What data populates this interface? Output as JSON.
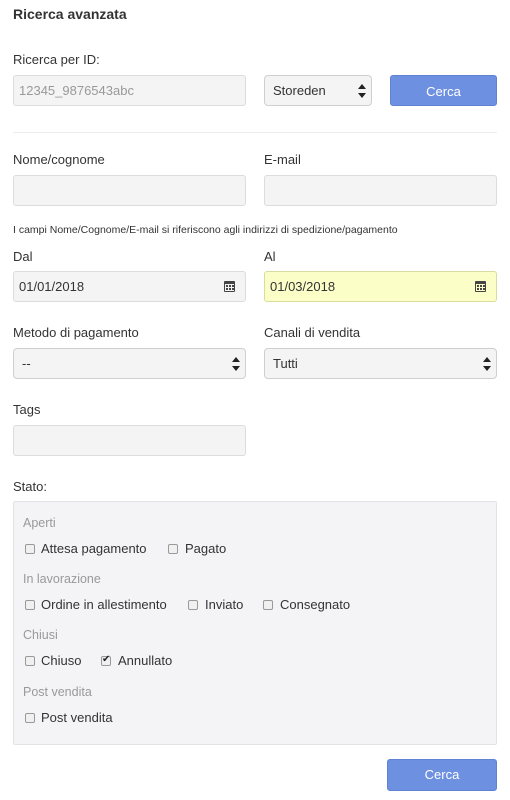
{
  "header": {
    "title": "Ricerca avanzata"
  },
  "id_search": {
    "label": "Ricerca per ID:",
    "value": "12345_9876543abc",
    "source_select": "Storeden",
    "button": "Cerca"
  },
  "name_field": {
    "label": "Nome/cognome",
    "value": ""
  },
  "email_field": {
    "label": "E-mail",
    "value": ""
  },
  "note": "I campi Nome/Cognome/E-mail si riferiscono agli indirizzi di spedizione/pagamento",
  "date_from": {
    "label": "Dal",
    "value": "01/01/2018"
  },
  "date_to": {
    "label": "Al",
    "value": "01/03/2018"
  },
  "payment_method": {
    "label": "Metodo di pagamento",
    "value": "--"
  },
  "sales_channels": {
    "label": "Canali di vendita",
    "value": "Tutti"
  },
  "tags": {
    "label": "Tags",
    "value": ""
  },
  "status": {
    "label": "Stato:",
    "groups": [
      {
        "title": "Aperti",
        "items": [
          {
            "label": "Attesa pagamento",
            "checked": false
          },
          {
            "label": "Pagato",
            "checked": false
          }
        ]
      },
      {
        "title": "In lavorazione",
        "items": [
          {
            "label": "Ordine in allestimento",
            "checked": false
          },
          {
            "label": "Inviato",
            "checked": false
          },
          {
            "label": "Consegnato",
            "checked": false
          }
        ]
      },
      {
        "title": "Chiusi",
        "items": [
          {
            "label": "Chiuso",
            "checked": false
          },
          {
            "label": "Annullato",
            "checked": true
          }
        ]
      },
      {
        "title": "Post vendita",
        "items": [
          {
            "label": "Post vendita",
            "checked": false
          }
        ]
      }
    ]
  },
  "footer": {
    "search_button": "Cerca"
  },
  "colors": {
    "accent": "#6e90e0",
    "highlight_field": "#fbffc7"
  }
}
